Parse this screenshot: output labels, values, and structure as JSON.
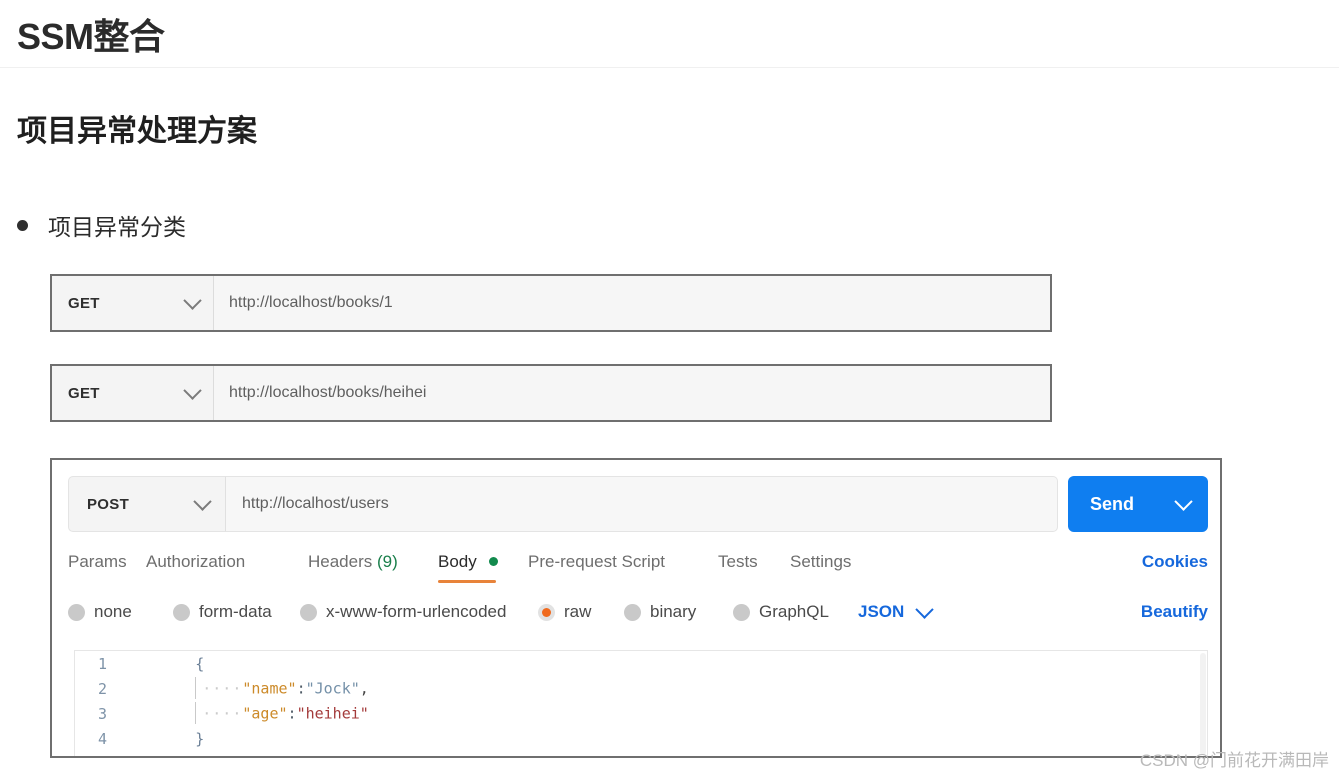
{
  "header": {
    "title": "SSM整合"
  },
  "section": {
    "title": "项目异常处理方案",
    "bullet": "项目异常分类"
  },
  "requests": [
    {
      "method": "GET",
      "url": "http://localhost/books/1"
    },
    {
      "method": "GET",
      "url": "http://localhost/books/heihei"
    }
  ],
  "postman": {
    "method": "POST",
    "url": "http://localhost/users",
    "send_label": "Send",
    "cookies_label": "Cookies",
    "beautify_label": "Beautify",
    "format_label": "JSON",
    "tabs": [
      {
        "label": "Params",
        "active": false
      },
      {
        "label": "Authorization",
        "active": false
      },
      {
        "label": "Headers",
        "count": "(9)",
        "active": false
      },
      {
        "label": "Body",
        "active": true,
        "has_dot": true
      },
      {
        "label": "Pre-request Script",
        "active": false
      },
      {
        "label": "Tests",
        "active": false
      },
      {
        "label": "Settings",
        "active": false
      }
    ],
    "body_types": [
      {
        "label": "none",
        "selected": false
      },
      {
        "label": "form-data",
        "selected": false
      },
      {
        "label": "x-www-form-urlencoded",
        "selected": false
      },
      {
        "label": "raw",
        "selected": true
      },
      {
        "label": "binary",
        "selected": false
      },
      {
        "label": "GraphQL",
        "selected": false
      }
    ],
    "code": {
      "lines": [
        "1",
        "2",
        "3",
        "4"
      ],
      "line1_brace": "{",
      "line2_key": "\"name\"",
      "line2_colon": ":",
      "line2_value": "\"Jock\"",
      "line2_comma": ",",
      "line3_key": "\"age\"",
      "line3_colon": ":",
      "line3_value": "\"heihei\"",
      "line4_brace": "}",
      "indent_dots": "····"
    }
  },
  "watermark": "CSDN @门前花开满田岸",
  "colors": {
    "accent_blue": "#0f7ef0",
    "link_blue": "#1668dc",
    "active_orange": "#e8833a",
    "radio_orange": "#f06a1e",
    "count_green": "#1a7f4b"
  }
}
